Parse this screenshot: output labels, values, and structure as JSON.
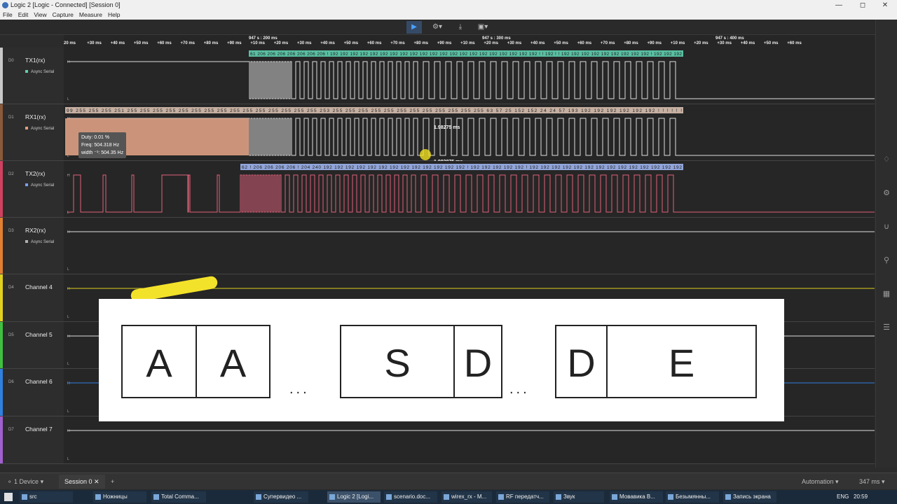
{
  "window": {
    "title": "Logic 2 [Logic - Connected] [Session 0]"
  },
  "menu": [
    "File",
    "Edit",
    "View",
    "Capture",
    "Measure",
    "Help"
  ],
  "ruler": {
    "big": [
      "947 s : 200 ms",
      "947 s : 300 ms",
      "947 s : 400 ms"
    ],
    "ticks": [
      "20 ms",
      "+30 ms",
      "+40 ms",
      "+50 ms",
      "+60 ms",
      "+70 ms",
      "+80 ms",
      "+90 ms",
      "+10 ms",
      "+20 ms",
      "+30 ms",
      "+40 ms",
      "+50 ms",
      "+60 ms",
      "+70 ms",
      "+80 ms",
      "+90 ms",
      "+10 ms",
      "+20 ms",
      "+30 ms",
      "+40 ms",
      "+50 ms",
      "+60 ms",
      "+70 ms",
      "+80 ms",
      "+90 ms",
      "+10 ms",
      "+20 ms",
      "+30 ms",
      "+40 ms",
      "+50 ms",
      "+60 ms"
    ]
  },
  "channels": [
    {
      "idx": "D0",
      "name": "TX1(rx)",
      "analyzer": "Async Serial",
      "color": "#c8c8c8",
      "acolor": "#5fd0b0"
    },
    {
      "idx": "D1",
      "name": "RX1(rx)",
      "analyzer": "Async Serial",
      "color": "#8a5a3a",
      "acolor": "#e0a080"
    },
    {
      "idx": "D2",
      "name": "TX2(rx)",
      "analyzer": "Async Serial",
      "color": "#d04060",
      "acolor": "#7aa0f0"
    },
    {
      "idx": "D3",
      "name": "RX2(rx)",
      "analyzer": "Async Serial",
      "color": "#e08030",
      "acolor": "#b0b0b0"
    },
    {
      "idx": "D4",
      "name": "Channel 4",
      "analyzer": "",
      "color": "#e0d020",
      "acolor": ""
    },
    {
      "idx": "D5",
      "name": "Channel 5",
      "analyzer": "",
      "color": "#40c040",
      "acolor": ""
    },
    {
      "idx": "D6",
      "name": "Channel 6",
      "analyzer": "",
      "color": "#3080e0",
      "acolor": ""
    },
    {
      "idx": "D7",
      "name": "Channel 7",
      "analyzer": "",
      "color": "#a060d0",
      "acolor": ""
    }
  ],
  "decodes": {
    "tx1": "61 206 206 206 206 206 206 206 ! 192 192 192 192 192 192 192 192 192 192 192 192 192 192 192 192 192 192 192 192 192 ! ! 192 ! ! 192 192 192 192 192 192 192 192 192 ! 192 192 192",
    "rx1": "99 255 255 255 251 255 255 255 255 255 255 255 255 255 255 255 255 255 255 255 253 255 255 255 255 255 255 255 255 255 255 255 255 63 57 25 152 152 24 24 57 193 192 192 192 192 192 192 ! ! ! ! ! !",
    "tx2": "62 ! 206 206 206 206 ! 204 240 192 192 192 192 192 192 192 192 192 192 192 192 192 ! 192 192 192 192 192 ! 192 192 192 192 192 192 192 192 192 192 192 192 192 192"
  },
  "measure": {
    "duty": "Duty: 0.01 %",
    "freq": "Freq: 504.318 Hz",
    "width": "width ⁻¹: 504.35 Hz",
    "top": "1.98275 ms",
    "bottom": "1.982875 ms"
  },
  "overlay": {
    "boxes": [
      "A",
      "A",
      "S",
      "D",
      "D",
      "E"
    ],
    "ellipsis": "..."
  },
  "status": {
    "device": "1 Device",
    "session": "Session 0",
    "add": "+",
    "automation": "Automation",
    "zoom": "347 ms"
  },
  "taskbar": {
    "items": [
      "src",
      "Ножницы",
      "Total Comma...",
      "Супервидео ...",
      "Logic 2 [Logi...",
      "scenario.doc...",
      "wirex_rx - M...",
      "RF передатч...",
      "Звук",
      "Мовавика В...",
      "Безымянны...",
      "Запись экрана"
    ],
    "lang": "ENG",
    "time": "20:59"
  }
}
